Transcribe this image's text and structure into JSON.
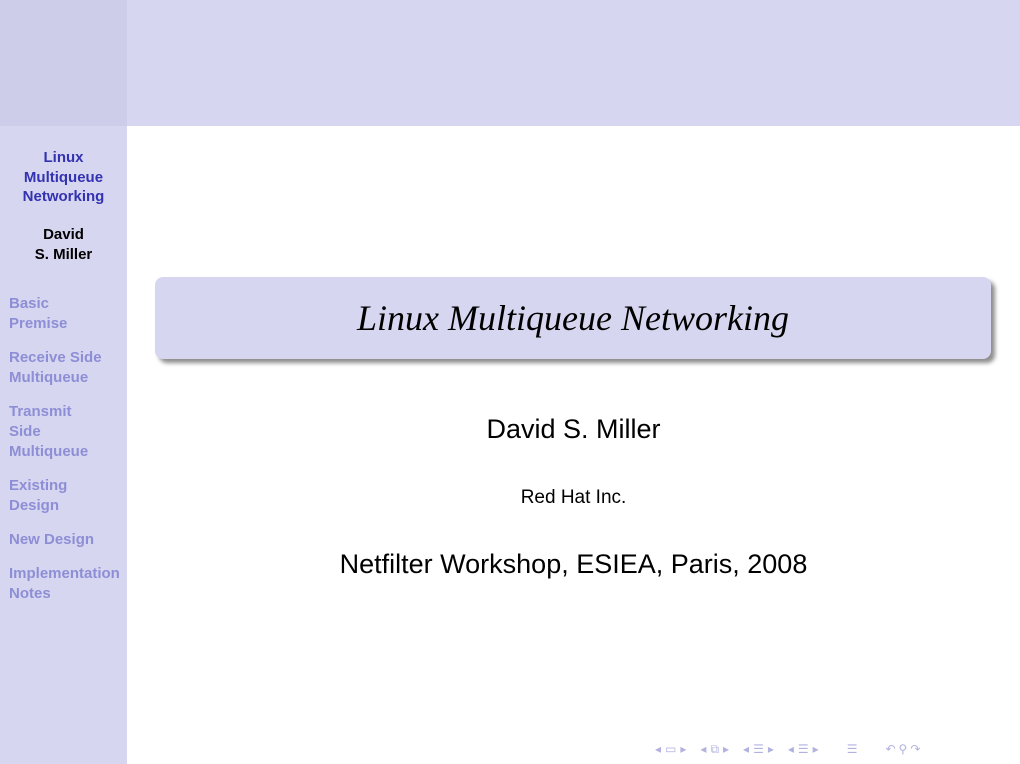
{
  "sidebar": {
    "title": "Linux\nMultiqueue\nNetworking",
    "author": "David\nS. Miller",
    "sections": [
      {
        "label": "Basic\nPremise"
      },
      {
        "label": "Receive Side\nMultiqueue"
      },
      {
        "label": "Transmit\nSide\nMultiqueue"
      },
      {
        "label": "Existing\nDesign"
      },
      {
        "label": "New Design"
      },
      {
        "label": "Implementation\nNotes"
      }
    ]
  },
  "slide": {
    "title": "Linux Multiqueue Networking",
    "author": "David S. Miller",
    "institute": "Red Hat Inc.",
    "date": "Netfilter Workshop, ESIEA, Paris, 2008"
  },
  "navigation": {
    "icons": [
      "frame-prev-icon",
      "frame-icon",
      "frame-next-icon",
      "subsection-prev-icon",
      "subsection-icon",
      "subsection-next-icon",
      "section-prev-icon",
      "section-icon",
      "section-next-icon",
      "subsection-prev-icon",
      "subsection-list-icon",
      "subsection-next-icon",
      "toc-icon",
      "back-icon",
      "search-icon",
      "forward-icon"
    ],
    "color": "#b2b2e0"
  },
  "colors": {
    "accent": "#3333b2",
    "sidebar_bg": "#d6d6f0",
    "sidebar_inactive": "#8e8ed6"
  }
}
